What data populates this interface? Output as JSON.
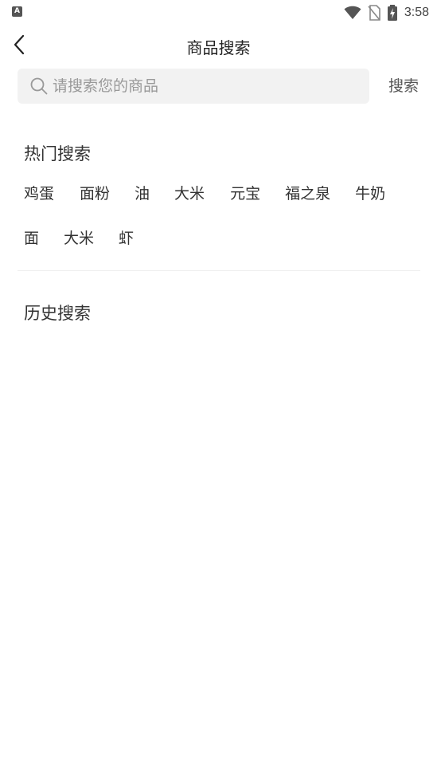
{
  "status_bar": {
    "app_badge": "A",
    "time": "3:58",
    "icons": [
      "wifi-icon",
      "no-sim-icon",
      "battery-charging-icon"
    ]
  },
  "header": {
    "back_icon": "chevron-left-icon",
    "title": "商品搜索"
  },
  "search": {
    "icon": "search-icon",
    "placeholder": "请搜索您的商品",
    "value": "",
    "button_label": "搜索"
  },
  "hot_search": {
    "title": "热门搜索",
    "rows": [
      [
        "鸡蛋",
        "面粉",
        "油",
        "大米",
        "元宝",
        "福之泉",
        "牛奶"
      ],
      [
        "面",
        "大米",
        "虾"
      ]
    ]
  },
  "history_search": {
    "title": "历史搜索",
    "items": []
  },
  "colors": {
    "background": "#ffffff",
    "search_box": "#f2f2f2",
    "text_primary": "#333333",
    "text_placeholder": "#999999",
    "divider": "#eeeeee"
  }
}
